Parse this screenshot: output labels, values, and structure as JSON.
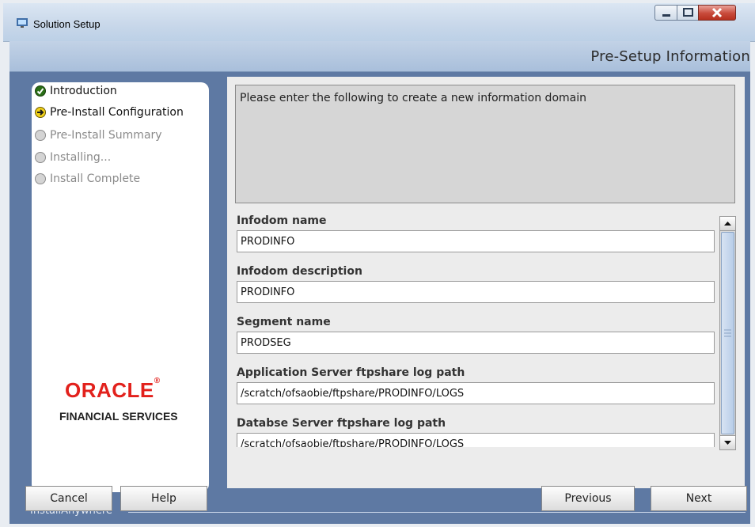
{
  "window": {
    "title": "Solution Setup",
    "minimize_icon": "minimize-icon",
    "maximize_icon": "maximize-icon",
    "close_icon": "close-icon"
  },
  "header": {
    "title": "Pre-Setup Information"
  },
  "steps": [
    {
      "label": "Introduction",
      "state": "done"
    },
    {
      "label": "Pre-Install Configuration",
      "state": "current"
    },
    {
      "label": "Pre-Install Summary",
      "state": "pending"
    },
    {
      "label": "Installing...",
      "state": "pending"
    },
    {
      "label": "Install Complete",
      "state": "pending"
    }
  ],
  "branding": {
    "logo": "ORACLE",
    "subtitle": "FINANCIAL SERVICES"
  },
  "content": {
    "instruction": "Please enter the following to create a new information domain",
    "fields": [
      {
        "label": "Infodom name",
        "value": "PRODINFO"
      },
      {
        "label": "Infodom description",
        "value": "PRODINFO"
      },
      {
        "label": "Segment name",
        "value": "PRODSEG"
      },
      {
        "label": "Application Server ftpshare log path",
        "value": "/scratch/ofsaobie/ftpshare/PRODINFO/LOGS"
      },
      {
        "label": "Databse Server ftpshare log path",
        "value": "/scratch/ofsaobie/ftpshare/PRODINFO/LOGS"
      }
    ]
  },
  "footer": {
    "label": "InstallAnywhere",
    "buttons": {
      "cancel": "Cancel",
      "help": "Help",
      "previous": "Previous",
      "next": "Next"
    }
  },
  "colors": {
    "accent_blue": "#5e79a3",
    "oracle_red": "#e2211c"
  }
}
